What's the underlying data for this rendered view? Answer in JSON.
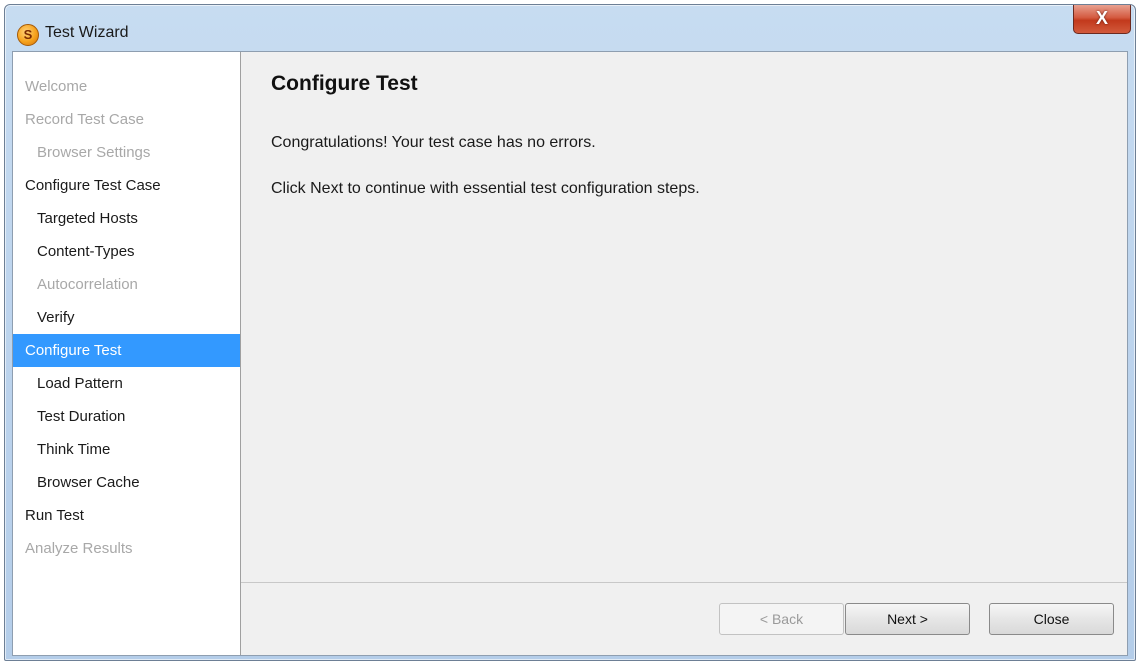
{
  "window": {
    "title": "Test Wizard",
    "app_icon_glyph": "S",
    "close_glyph": "X"
  },
  "sidebar": {
    "items": [
      {
        "label": "Welcome",
        "level": 0,
        "state": "disabled"
      },
      {
        "label": "Record Test Case",
        "level": 0,
        "state": "disabled"
      },
      {
        "label": "Browser Settings",
        "level": 1,
        "state": "disabled"
      },
      {
        "label": "Configure Test Case",
        "level": 0,
        "state": "enabled"
      },
      {
        "label": "Targeted Hosts",
        "level": 1,
        "state": "enabled"
      },
      {
        "label": "Content-Types",
        "level": 1,
        "state": "enabled"
      },
      {
        "label": "Autocorrelation",
        "level": 1,
        "state": "disabled"
      },
      {
        "label": "Verify",
        "level": 1,
        "state": "enabled"
      },
      {
        "label": "Configure Test",
        "level": 0,
        "state": "selected"
      },
      {
        "label": "Load Pattern",
        "level": 1,
        "state": "enabled"
      },
      {
        "label": "Test Duration",
        "level": 1,
        "state": "enabled"
      },
      {
        "label": "Think Time",
        "level": 1,
        "state": "enabled"
      },
      {
        "label": "Browser Cache",
        "level": 1,
        "state": "enabled"
      },
      {
        "label": "Run Test",
        "level": 0,
        "state": "enabled"
      },
      {
        "label": "Analyze Results",
        "level": 0,
        "state": "disabled"
      }
    ]
  },
  "main": {
    "title": "Configure Test",
    "message1": "Congratulations! Your test case has no errors.",
    "message2": "Click Next to continue with essential test configuration steps."
  },
  "buttons": {
    "back": "< Back",
    "next": "Next >",
    "close": "Close"
  },
  "colors": {
    "selection": "#3399ff",
    "disabled_text": "#a8a8a8",
    "close_button": "#c2391c"
  }
}
